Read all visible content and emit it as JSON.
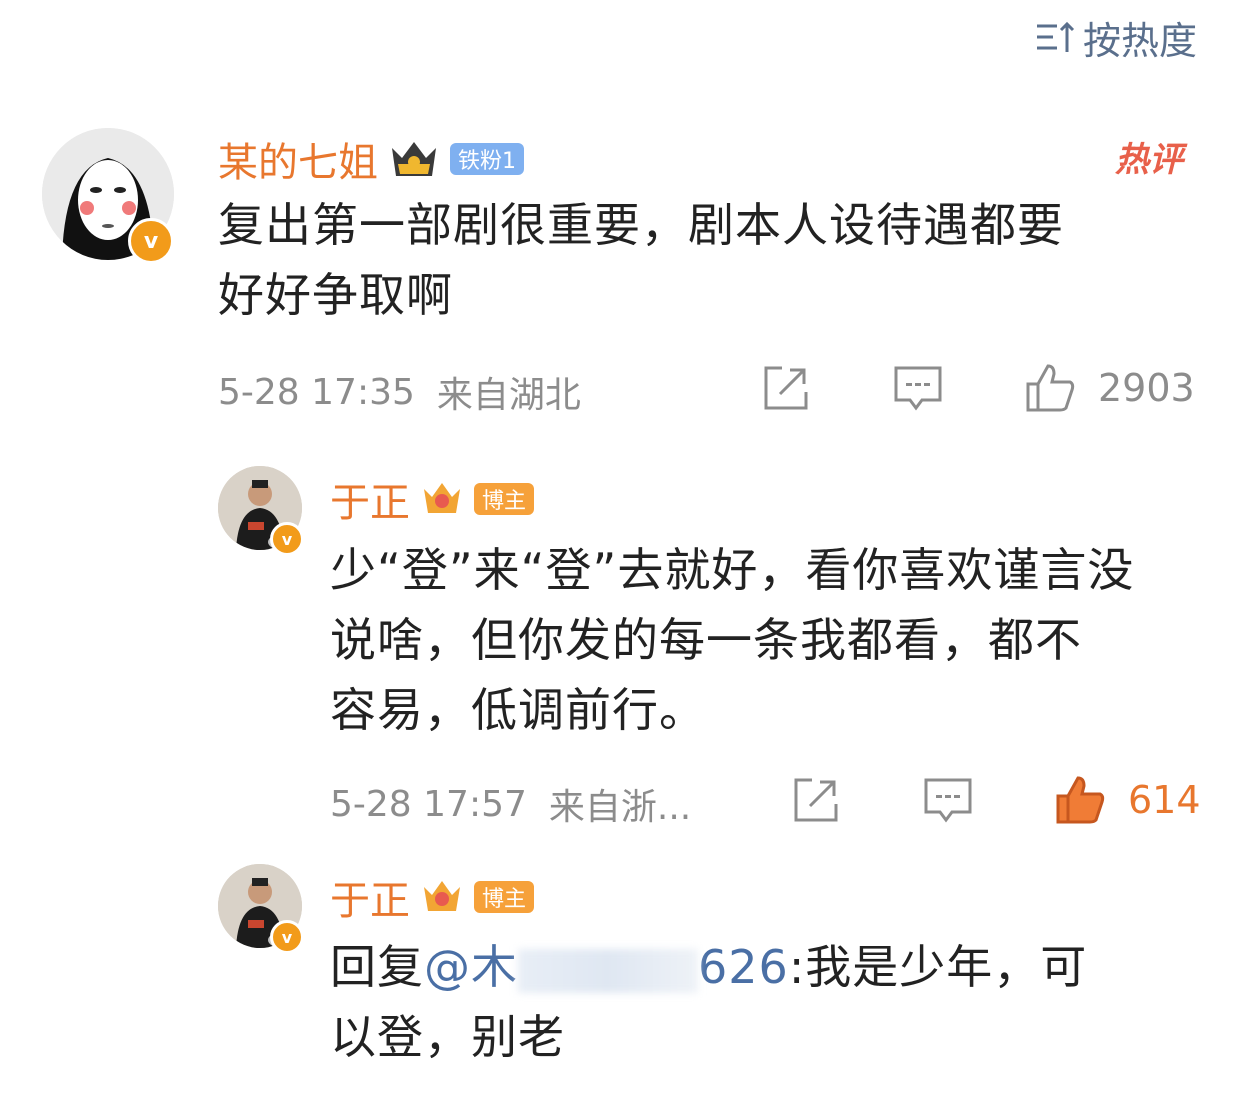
{
  "sort": {
    "label": "按热度"
  },
  "comments": [
    {
      "user": "某的七姐",
      "badge": "铁粉1",
      "hot_tag": "热评",
      "text_lines": [
        "复出第一部剧很重要，剧本人设待遇都要",
        "好好争取啊"
      ],
      "time": "5-28 17:35",
      "location": "来自湖北",
      "likes": "2903"
    },
    {
      "user": "于正",
      "badge": "博主",
      "text_lines": [
        "少“登”来“登”去就好，看你喜欢谨言没",
        "说啥，但你发的每一条我都看，都不",
        "容易，低调前行。"
      ],
      "time": "5-28 17:57",
      "location": "来自浙...",
      "likes": "614"
    },
    {
      "user": "于正",
      "badge": "博主",
      "reply_prefix": "回复",
      "mention_start": "@木",
      "mention_end": "626",
      "reply_text": ":我是少年，可",
      "reply_line2": "以登，别老"
    }
  ],
  "colors": {
    "accent": "#e8772e",
    "meta": "#8c8c8c",
    "link": "#4a6fa5",
    "tag_blue": "#7fb0f0",
    "tag_orange": "#f6a13a"
  }
}
